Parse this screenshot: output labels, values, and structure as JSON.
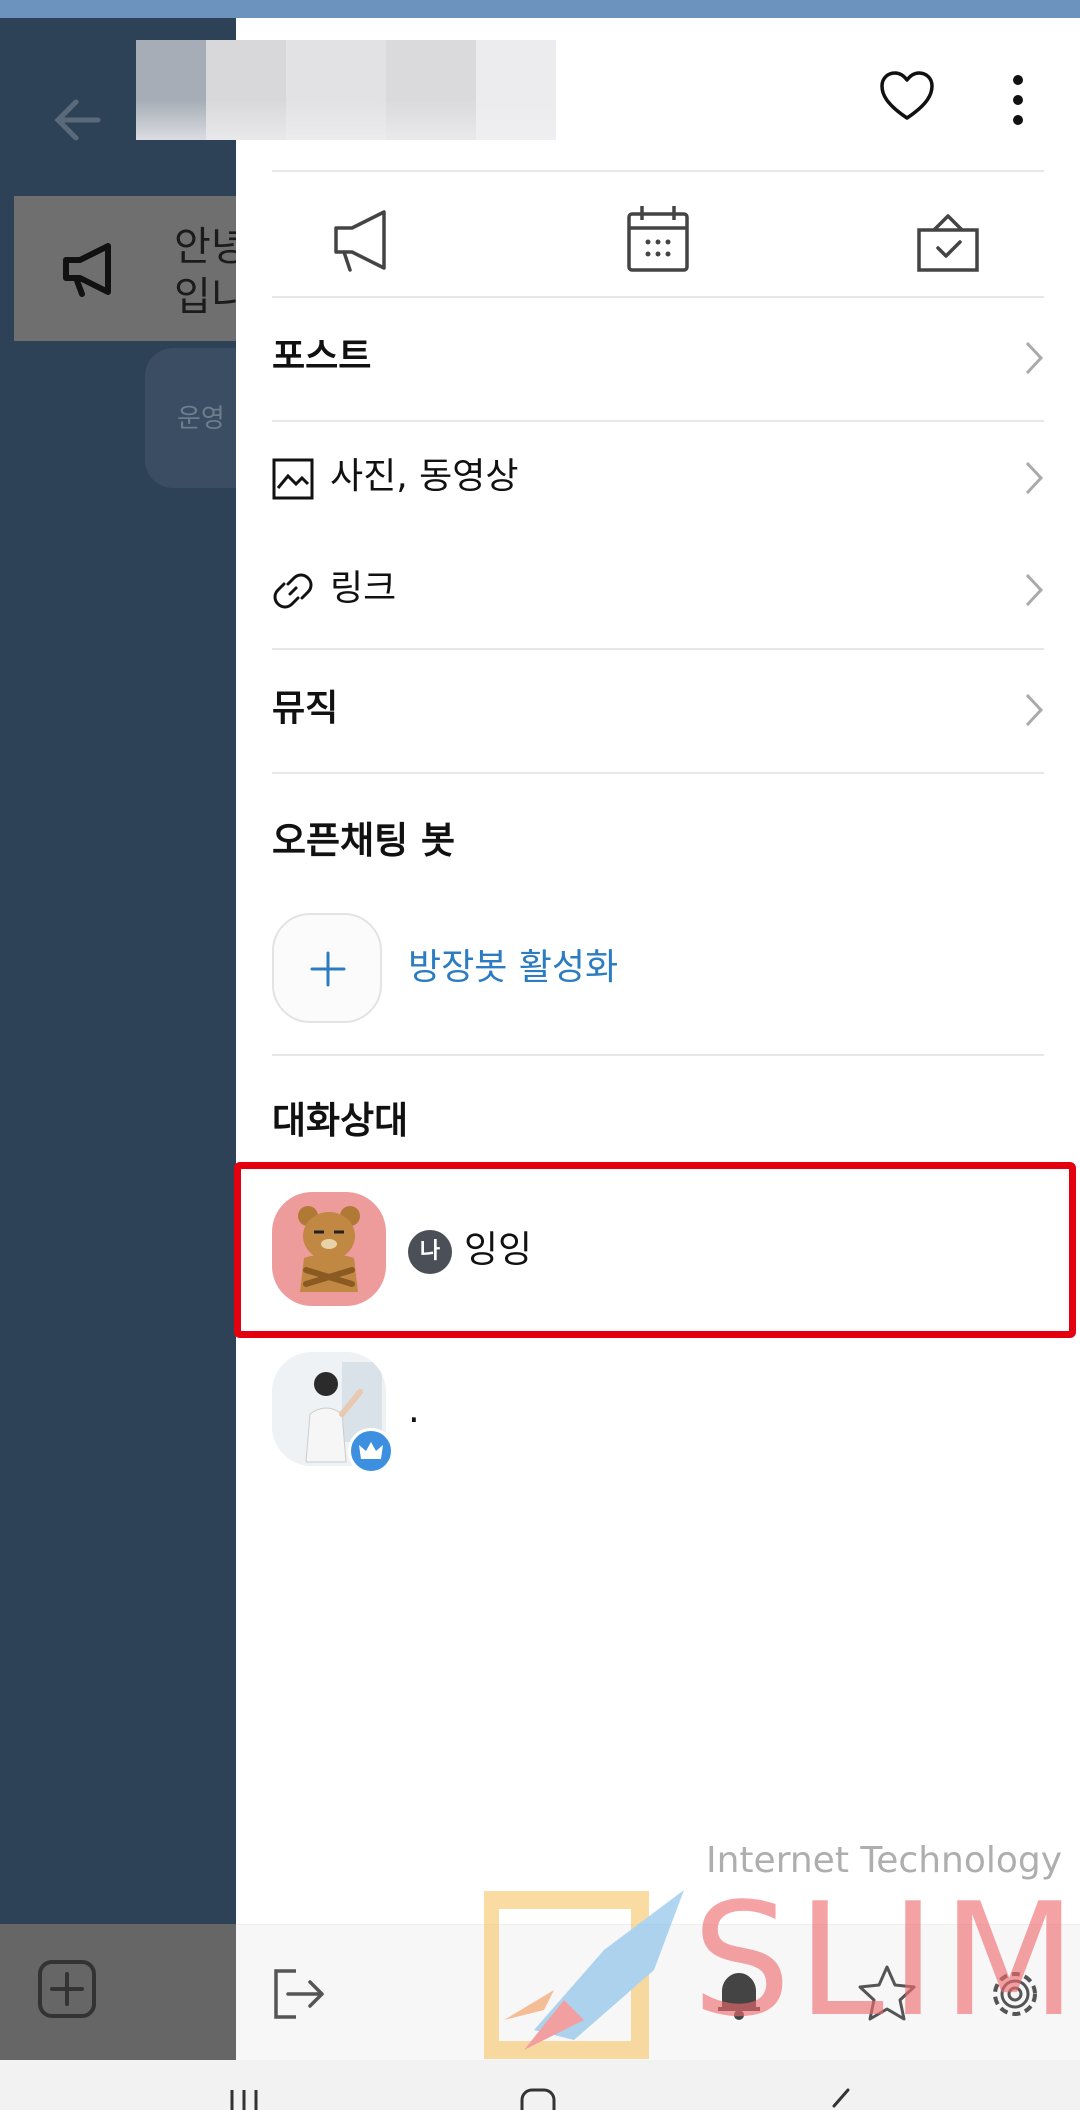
{
  "background_chat": {
    "notice_text": "안녕\n입니",
    "bubble_text": "운영"
  },
  "drawer": {
    "quick_actions": [
      {
        "icon": "megaphone-icon",
        "name": "notice"
      },
      {
        "icon": "calendar-icon",
        "name": "calendar"
      },
      {
        "icon": "vote-box-icon",
        "name": "vote"
      }
    ],
    "menu": {
      "post": "포스트",
      "photos_videos": "사진, 동영상",
      "links": "링크",
      "music": "뮤직"
    },
    "bot_section": {
      "title": "오픈채팅 봇",
      "activate_label": "방장봇 활성화"
    },
    "members_section": {
      "title": "대화상대",
      "members": [
        {
          "badge": "나",
          "name": "잉잉",
          "avatar": "ryan-character-avatar",
          "highlighted": true
        },
        {
          "badge": "",
          "name": ".",
          "avatar": "photo-avatar",
          "crown": true
        }
      ]
    }
  },
  "watermark": {
    "line1": "Internet Technology",
    "line2": "SLIM"
  },
  "colors": {
    "link_blue": "#2b7cc0",
    "highlight_red": "#e4000f",
    "avatar_pink": "#ee9b9b",
    "crown_blue": "#3d8fe0"
  }
}
